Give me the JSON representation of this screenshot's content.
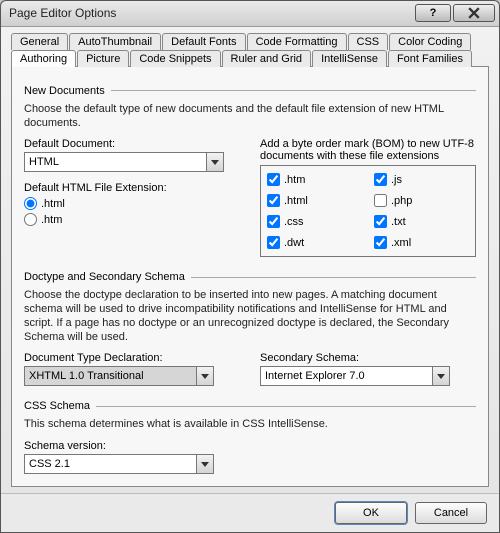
{
  "title": "Page Editor Options",
  "tabs_row1": [
    "General",
    "AutoThumbnail",
    "Default Fonts",
    "Code Formatting",
    "CSS",
    "Color Coding"
  ],
  "tabs_row2": [
    "Authoring",
    "Picture",
    "Code Snippets",
    "Ruler and Grid",
    "IntelliSense",
    "Font Families"
  ],
  "active_tab": "Authoring",
  "newdocs": {
    "heading": "New Documents",
    "desc": "Choose the default type of new documents and the default file extension of new HTML documents.",
    "default_doc_label": "Default Document:",
    "default_doc_value": "HTML",
    "default_ext_label": "Default HTML File Extension:",
    "ext_options": [
      ".html",
      ".htm"
    ],
    "ext_selected": ".html",
    "bom_label": "Add a byte order mark (BOM) to new UTF-8 documents with these file extensions",
    "bom_items": [
      {
        "label": ".htm",
        "checked": true
      },
      {
        "label": ".js",
        "checked": true
      },
      {
        "label": ".html",
        "checked": true
      },
      {
        "label": ".php",
        "checked": false
      },
      {
        "label": ".css",
        "checked": true
      },
      {
        "label": ".txt",
        "checked": true
      },
      {
        "label": ".dwt",
        "checked": true
      },
      {
        "label": ".xml",
        "checked": true
      }
    ]
  },
  "doctype": {
    "heading": "Doctype and Secondary Schema",
    "desc": "Choose the doctype declaration to be inserted into new pages. A matching document schema will be used to drive incompatibility notifications and IntelliSense for HTML and script. If a page has no doctype or an unrecognized doctype is declared, the Secondary Schema will be used.",
    "dtd_label": "Document Type Declaration:",
    "dtd_value": "XHTML 1.0 Transitional",
    "secondary_label": "Secondary Schema:",
    "secondary_value": "Internet Explorer 7.0"
  },
  "css": {
    "heading": "CSS Schema",
    "desc": "This schema determines what is available in CSS IntelliSense.",
    "version_label": "Schema version:",
    "version_value": "CSS 2.1"
  },
  "buttons": {
    "ok": "OK",
    "cancel": "Cancel"
  }
}
